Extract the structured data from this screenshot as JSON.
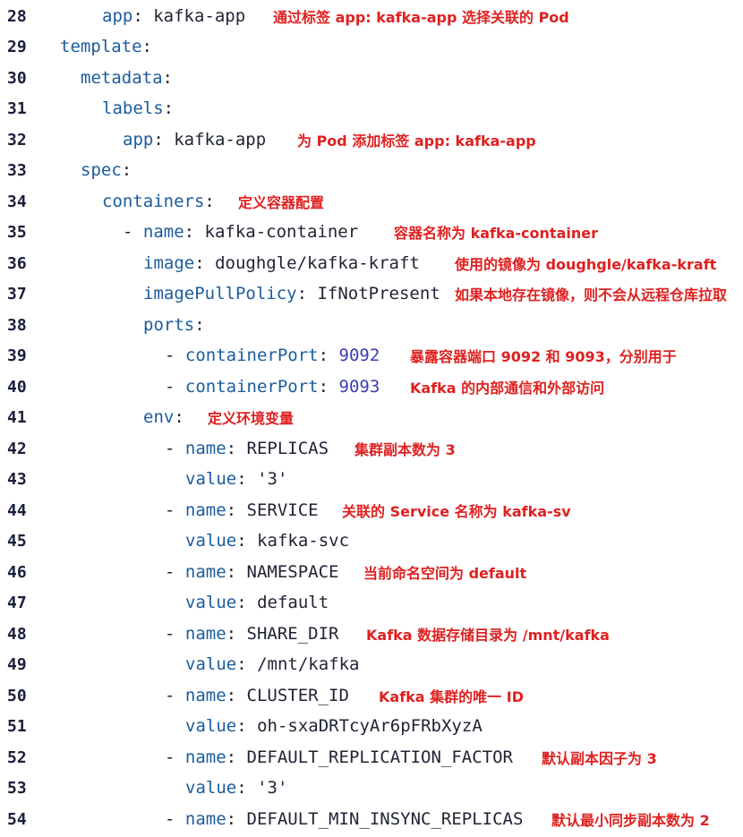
{
  "lines": [
    {
      "n": "28",
      "dash": "",
      "key": "app",
      "sep": ":",
      "val": " kafka-app",
      "val_type": "str",
      "note": "通过标签 app: kafka-app 选择关联的 Pod"
    },
    {
      "n": "29",
      "dash": "",
      "key": "template",
      "sep": ":",
      "val": "",
      "val_type": "str",
      "note": ""
    },
    {
      "n": "30",
      "dash": "",
      "key": "metadata",
      "sep": ":",
      "val": "",
      "val_type": "str",
      "note": ""
    },
    {
      "n": "31",
      "dash": "",
      "key": "labels",
      "sep": ":",
      "val": "",
      "val_type": "str",
      "note": ""
    },
    {
      "n": "32",
      "dash": "",
      "key": "app",
      "sep": ":",
      "val": " kafka-app",
      "val_type": "str",
      "note": "为 Pod 添加标签 app: kafka-app"
    },
    {
      "n": "33",
      "dash": "",
      "key": "spec",
      "sep": ":",
      "val": "",
      "val_type": "str",
      "note": ""
    },
    {
      "n": "34",
      "dash": "",
      "key": "containers",
      "sep": ":",
      "val": "",
      "val_type": "str",
      "note": "定义容器配置"
    },
    {
      "n": "35",
      "dash": "- ",
      "key": "name",
      "sep": ":",
      "val": " kafka-container",
      "val_type": "str",
      "note": "容器名称为 kafka-container"
    },
    {
      "n": "36",
      "dash": "",
      "key": "image",
      "sep": ":",
      "val": " doughgle/kafka-kraft",
      "val_type": "str",
      "note": "使用的镜像为 doughgle/kafka-kraft"
    },
    {
      "n": "37",
      "dash": "",
      "key": "imagePullPolicy",
      "sep": ":",
      "val": " IfNotPresent",
      "val_type": "str",
      "note": "如果本地存在镜像，则不会从远程仓库拉取"
    },
    {
      "n": "38",
      "dash": "",
      "key": "ports",
      "sep": ":",
      "val": "",
      "val_type": "str",
      "note": ""
    },
    {
      "n": "39",
      "dash": "- ",
      "key": "containerPort",
      "sep": ":",
      "val": " 9092",
      "val_type": "num",
      "note": "暴露容器端口 9092 和 9093，分别用于"
    },
    {
      "n": "40",
      "dash": "- ",
      "key": "containerPort",
      "sep": ":",
      "val": " 9093",
      "val_type": "num",
      "note": "Kafka 的内部通信和外部访问"
    },
    {
      "n": "41",
      "dash": "",
      "key": "env",
      "sep": ":",
      "val": "",
      "val_type": "str",
      "note": "定义环境变量"
    },
    {
      "n": "42",
      "dash": "- ",
      "key": "name",
      "sep": ":",
      "val": " REPLICAS",
      "val_type": "str",
      "note": "集群副本数为 3"
    },
    {
      "n": "43",
      "dash": "",
      "key": "value",
      "sep": ":",
      "val": " '3'",
      "val_type": "str",
      "note": ""
    },
    {
      "n": "44",
      "dash": "- ",
      "key": "name",
      "sep": ":",
      "val": " SERVICE",
      "val_type": "str",
      "note": "关联的 Service 名称为 kafka-sv"
    },
    {
      "n": "45",
      "dash": "",
      "key": "value",
      "sep": ":",
      "val": " kafka-svc",
      "val_type": "str",
      "note": ""
    },
    {
      "n": "46",
      "dash": "- ",
      "key": "name",
      "sep": ":",
      "val": " NAMESPACE",
      "val_type": "str",
      "note": "当前命名空间为 default"
    },
    {
      "n": "47",
      "dash": "",
      "key": "value",
      "sep": ":",
      "val": " default",
      "val_type": "str",
      "note": ""
    },
    {
      "n": "48",
      "dash": "- ",
      "key": "name",
      "sep": ":",
      "val": " SHARE_DIR",
      "val_type": "str",
      "note": "Kafka 数据存储目录为 /mnt/kafka"
    },
    {
      "n": "49",
      "dash": "",
      "key": "value",
      "sep": ":",
      "val": " /mnt/kafka",
      "val_type": "str",
      "note": ""
    },
    {
      "n": "50",
      "dash": "- ",
      "key": "name",
      "sep": ":",
      "val": " CLUSTER_ID",
      "val_type": "str",
      "note": "Kafka 集群的唯一 ID"
    },
    {
      "n": "51",
      "dash": "",
      "key": "value",
      "sep": ":",
      "val": " oh-sxaDRTcyAr6pFRbXyzA",
      "val_type": "str",
      "note": ""
    },
    {
      "n": "52",
      "dash": "- ",
      "key": "name",
      "sep": ":",
      "val": " DEFAULT_REPLICATION_FACTOR",
      "val_type": "str",
      "note": "默认副本因子为 3"
    },
    {
      "n": "53",
      "dash": "",
      "key": "value",
      "sep": ":",
      "val": " '3'",
      "val_type": "str",
      "note": ""
    },
    {
      "n": "54",
      "dash": "- ",
      "key": "name",
      "sep": ":",
      "val": " DEFAULT_MIN_INSYNC_REPLICAS",
      "val_type": "str",
      "note": "默认最小同步副本数为 2"
    }
  ]
}
